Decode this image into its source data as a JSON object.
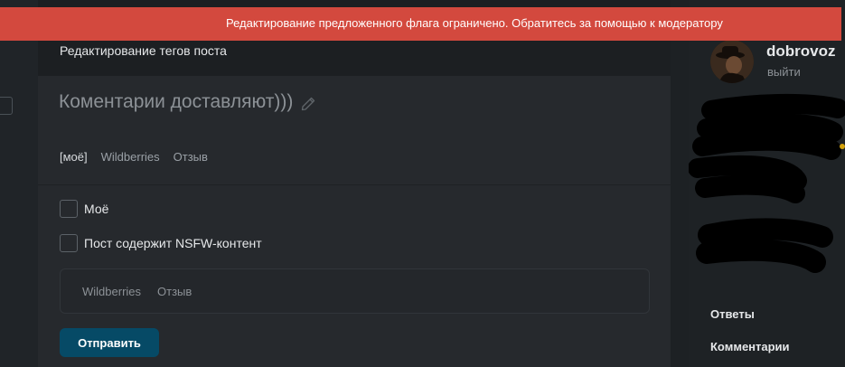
{
  "banner": {
    "text": "Редактирование предложенного флага ограничено. Обратитесь за помощью к модератору",
    "color": "#d3493e"
  },
  "editor": {
    "header_title": "Редактирование тегов поста",
    "post_title": "Коментарии доставляют)))",
    "edit_icon": "pencil-icon",
    "current_tags": [
      {
        "label": "[моё]"
      },
      {
        "label": "Wildberries"
      },
      {
        "label": "Отзыв"
      }
    ],
    "checkboxes": [
      {
        "label": "Моё",
        "checked": false
      },
      {
        "label": "Пост содержит NSFW-контент",
        "checked": false
      }
    ],
    "tag_input_chips": [
      {
        "label": "Wildberries"
      },
      {
        "label": "Отзыв"
      }
    ],
    "submit_label": "Отправить",
    "accent": "#064a66"
  },
  "user": {
    "username": "dobrovoz",
    "logout_label": "выйти"
  },
  "sidebar": {
    "links": [
      {
        "label": "Ответы"
      },
      {
        "label": "Комментарии"
      }
    ]
  }
}
